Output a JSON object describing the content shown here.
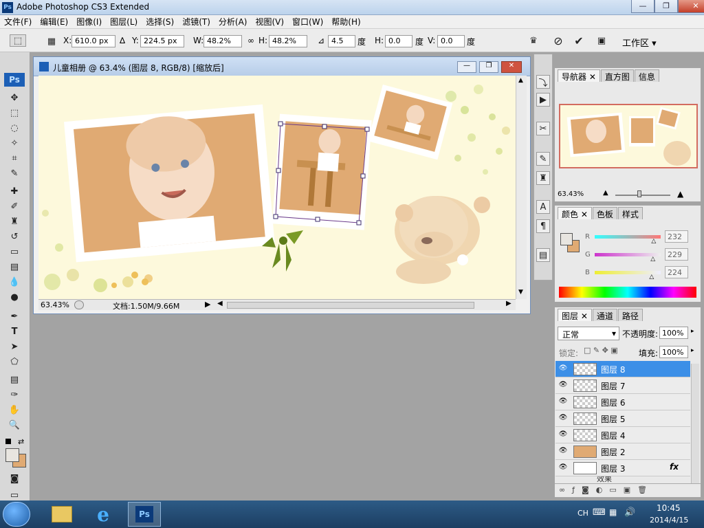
{
  "app": {
    "title": "Adobe Photoshop CS3 Extended",
    "logo_text": "Ps"
  },
  "window_buttons": {
    "minimize": "—",
    "restore": "❐",
    "close": "✕"
  },
  "menu": [
    "文件(F)",
    "编辑(E)",
    "图像(I)",
    "图层(L)",
    "选择(S)",
    "滤镜(T)",
    "分析(A)",
    "视图(V)",
    "窗口(W)",
    "帮助(H)"
  ],
  "options": {
    "x_label": "X:",
    "x_value": "610.0 px",
    "y_label": "Y:",
    "y_value": "224.5 px",
    "w_label": "W:",
    "w_value": "48.2%",
    "h_label": "H:",
    "h_value": "48.2%",
    "angle_value": "4.5",
    "angle_unit": "度",
    "hskew_label": "H:",
    "hskew_value": "0.0",
    "hskew_unit": "度",
    "vskew_label": "V:",
    "vskew_value": "0.0",
    "vskew_unit": "度",
    "workspace": "工作区 ▾"
  },
  "document": {
    "title": "儿童相册 @ 63.4% (图层 8, RGB/8) [缩放后]",
    "zoom": "63.43%",
    "doc_info": "文档:1.50M/9.66M"
  },
  "navigator_panel": {
    "tabs": [
      "导航器",
      "直方图",
      "信息"
    ],
    "zoom": "63.43%"
  },
  "color_panel": {
    "tabs": [
      "颜色",
      "色板",
      "样式"
    ],
    "r_label": "R",
    "r_value": "232",
    "g_label": "G",
    "g_value": "229",
    "b_label": "B",
    "b_value": "224",
    "r_level": 232,
    "g_level": 229,
    "b_level": 224
  },
  "layers_panel": {
    "tabs": [
      "图层",
      "通道",
      "路径"
    ],
    "blend_mode": "正常",
    "opacity_label": "不透明度:",
    "opacity": "100%",
    "lock_label": "锁定:",
    "fill_label": "填充:",
    "fill": "100%",
    "layers": [
      {
        "name": "图层 8",
        "selected": true
      },
      {
        "name": "图层 7",
        "selected": false
      },
      {
        "name": "图层 6",
        "selected": false
      },
      {
        "name": "图层 5",
        "selected": false
      },
      {
        "name": "图层 4",
        "selected": false
      },
      {
        "name": "图层 2",
        "selected": false
      },
      {
        "name": "图层 3",
        "selected": false,
        "fx": "fx"
      }
    ],
    "partial_row": "效果"
  },
  "taskbar": {
    "lang": "CH",
    "time": "10:45",
    "date": "2014/4/15",
    "ps_label": "Ps"
  },
  "colors": {
    "accent": "#3c8fe7",
    "canvas": "#fdf9dc",
    "photo_bg": "#e0aa73"
  }
}
